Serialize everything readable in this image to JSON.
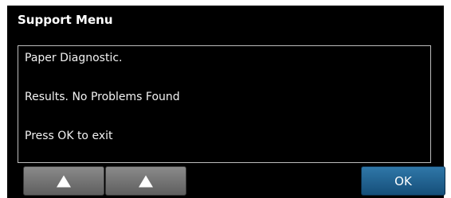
{
  "header": {
    "title": "Support Menu"
  },
  "message": {
    "line1": "Paper Diagnostic.",
    "line2": "Results. No Problems Found",
    "line3": "Press OK to exit"
  },
  "buttons": {
    "up_icon": "up-triangle-icon",
    "ok_label": "OK"
  },
  "colors": {
    "background": "#000000",
    "ok_button": "#1f5f8f",
    "nav_button": "#6f6f6f",
    "text": "#ffffff"
  }
}
